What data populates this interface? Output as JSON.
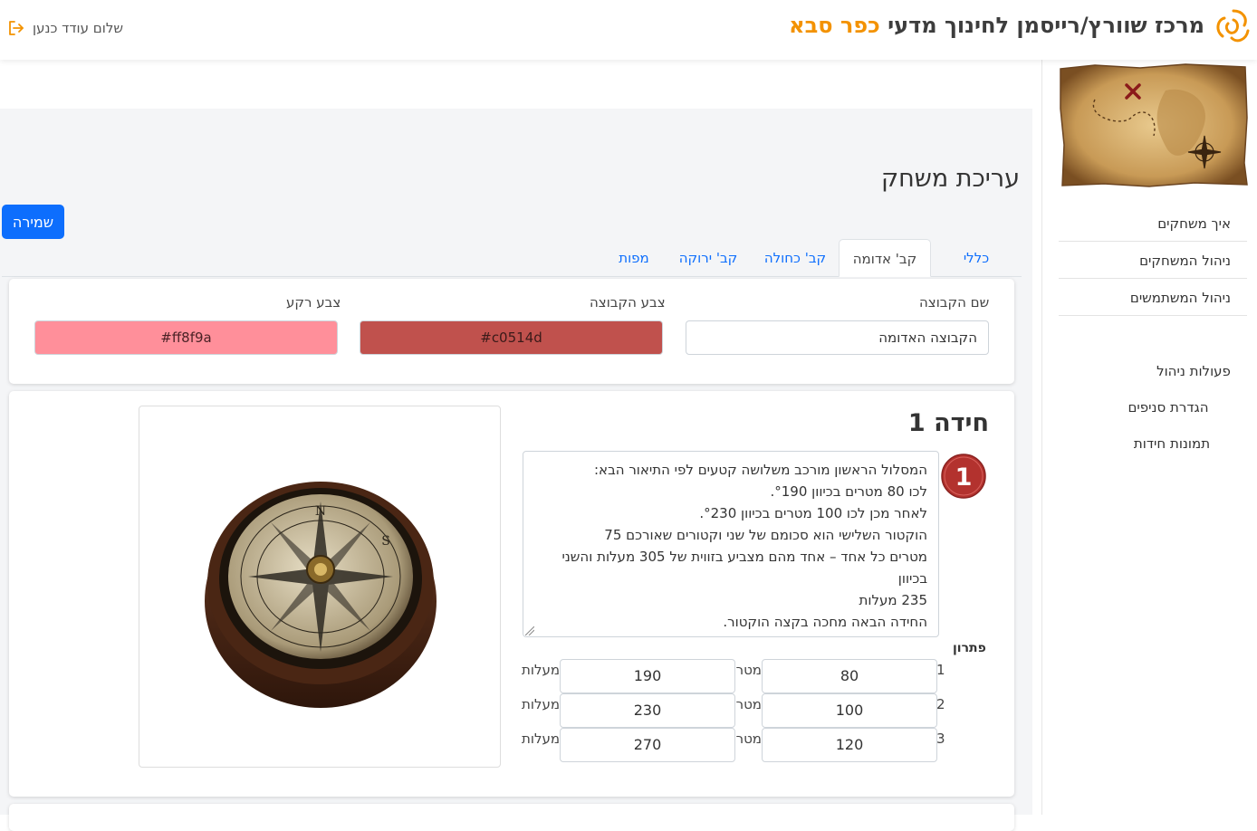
{
  "header": {
    "brand_main": "מרכז שוורץ/רייסמן לחינוך מדעי",
    "brand_city": "כפר סבא",
    "user_greeting": "שלום עודד כנען",
    "logo_icon": "swirl-logo-icon",
    "logout_icon": "logout-icon"
  },
  "sidebar": {
    "nav": [
      {
        "label": "איך משחקים"
      },
      {
        "label": "ניהול המשחקים"
      },
      {
        "label": "ניהול המשתמשים"
      }
    ],
    "admin": [
      {
        "label": "פעולות ניהול"
      },
      {
        "label": "הגדרת סניפים"
      },
      {
        "label": "תמונות חידות"
      }
    ]
  },
  "page": {
    "title": "עריכת משחק",
    "save_label": "שמירה",
    "tabs": [
      {
        "label": "כללי",
        "active": false
      },
      {
        "label": "קב' אדומה",
        "active": true
      },
      {
        "label": "קב' כחולה",
        "active": false
      },
      {
        "label": "קב' ירוקה",
        "active": false
      },
      {
        "label": "מפות",
        "active": false
      }
    ]
  },
  "group": {
    "name_label": "שם הקבוצה",
    "name_value": "הקבוצה האדומה",
    "color_label": "צבע הקבוצה",
    "color_value": "#c0514d",
    "color_display": "c0514d#",
    "bg_label": "צבע רקע",
    "bg_value": "#ff8f9a",
    "bg_display": "ff8f9a#"
  },
  "riddle": {
    "title": "חידה 1",
    "badge_number": "1",
    "text": "המסלול הראשון מורכב משלושה קטעים לפי התיאור הבא:\nלכו 80 מטרים בכיוון °190.\nלאחר מכן לכו 100 מטרים בכיוון °230.\nהוקטור השלישי הוא סכומם של שני וקטורים שאורכם 75\nמטרים כל אחד – אחד מהם מצביע בזווית של 305 מעלות והשני בכיוון\n235 מעלות\nהחידה הבאה מחכה בקצה הוקטור.",
    "solution_label": "פתרון",
    "meters_label": "מטר",
    "degrees_label": "מעלות",
    "solution_rows": [
      {
        "num": "1",
        "meters": "80",
        "degrees": "190"
      },
      {
        "num": "2",
        "meters": "100",
        "degrees": "230"
      },
      {
        "num": "3",
        "meters": "120",
        "degrees": "270"
      }
    ],
    "image_icon": "compass-image"
  }
}
